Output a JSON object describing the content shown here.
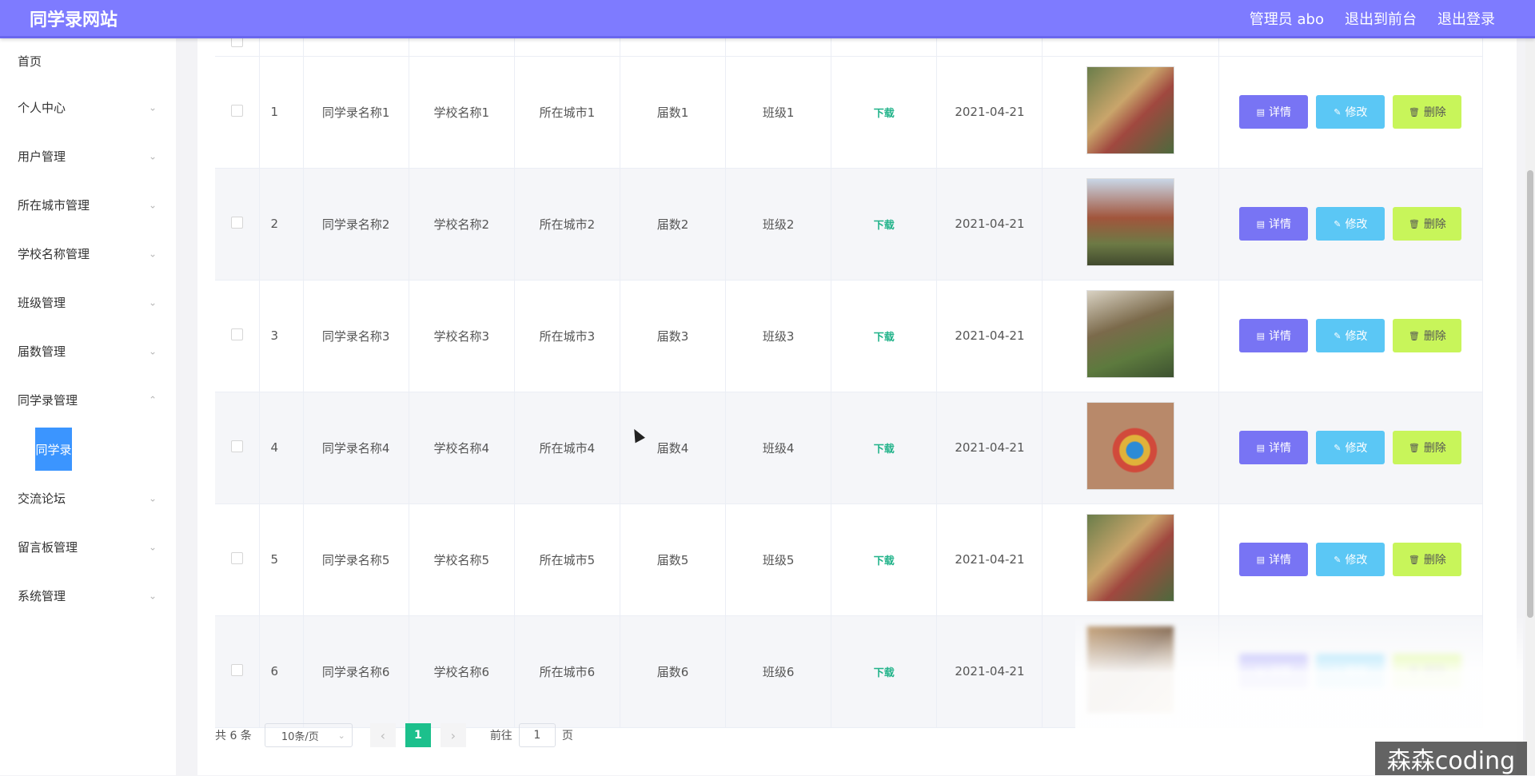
{
  "header": {
    "brand": "同学录网站",
    "admin": "管理员 abo",
    "to_front": "退出到前台",
    "logout": "退出登录"
  },
  "sidebar": {
    "items": [
      {
        "label": "首页",
        "has_arrow": false
      },
      {
        "label": "个人中心",
        "has_arrow": true,
        "arrow": "down"
      },
      {
        "label": "用户管理",
        "has_arrow": true,
        "arrow": "down"
      },
      {
        "label": "所在城市管理",
        "has_arrow": true,
        "arrow": "down"
      },
      {
        "label": "学校名称管理",
        "has_arrow": true,
        "arrow": "down"
      },
      {
        "label": "班级管理",
        "has_arrow": true,
        "arrow": "down"
      },
      {
        "label": "届数管理",
        "has_arrow": true,
        "arrow": "down"
      },
      {
        "label": "同学录管理",
        "has_arrow": true,
        "arrow": "up"
      },
      {
        "label": "交流论坛",
        "has_arrow": true,
        "arrow": "down"
      },
      {
        "label": "留言板管理",
        "has_arrow": true,
        "arrow": "down"
      },
      {
        "label": "系统管理",
        "has_arrow": true,
        "arrow": "down"
      }
    ],
    "active_sub": "同学录"
  },
  "table": {
    "download_label": "下载",
    "buttons": {
      "detail": "详情",
      "edit": "修改",
      "delete": "删除"
    },
    "rows": [
      {
        "idx": "1",
        "name": "同学录名称1",
        "school": "学校名称1",
        "city": "所在城市1",
        "session": "届数1",
        "class": "班级1",
        "date": "2021-04-21"
      },
      {
        "idx": "2",
        "name": "同学录名称2",
        "school": "学校名称2",
        "city": "所在城市2",
        "session": "届数2",
        "class": "班级2",
        "date": "2021-04-21"
      },
      {
        "idx": "3",
        "name": "同学录名称3",
        "school": "学校名称3",
        "city": "所在城市3",
        "session": "届数3",
        "class": "班级3",
        "date": "2021-04-21"
      },
      {
        "idx": "4",
        "name": "同学录名称4",
        "school": "学校名称4",
        "city": "所在城市4",
        "session": "届数4",
        "class": "班级4",
        "date": "2021-04-21"
      },
      {
        "idx": "5",
        "name": "同学录名称5",
        "school": "学校名称5",
        "city": "所在城市5",
        "session": "届数5",
        "class": "班级5",
        "date": "2021-04-21"
      },
      {
        "idx": "6",
        "name": "同学录名称6",
        "school": "学校名称6",
        "city": "所在城市6",
        "session": "届数6",
        "class": "班级6",
        "date": "2021-04-21"
      }
    ]
  },
  "pagination": {
    "total": "共 6 条",
    "page_size": "10条/页",
    "current": "1",
    "goto_prefix": "前往",
    "goto_value": "1",
    "goto_suffix": "页"
  },
  "watermark": "森森coding"
}
